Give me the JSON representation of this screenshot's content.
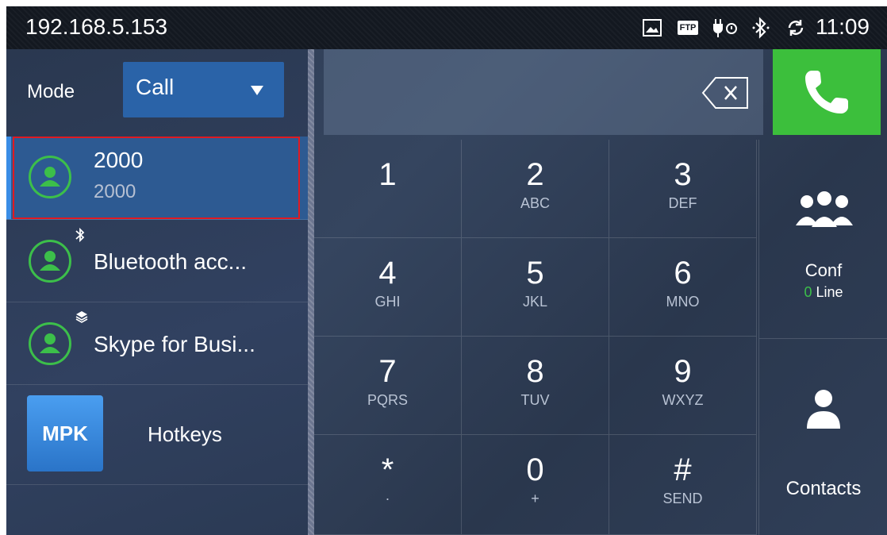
{
  "status_bar": {
    "ip": "192.168.5.153",
    "icons": [
      "image-icon",
      "ftp-icon",
      "usb-icon",
      "bluetooth-icon",
      "sync-icon"
    ],
    "ftp_label": "FTP",
    "time": "11:09"
  },
  "mode": {
    "label": "Mode",
    "selected": "Call"
  },
  "accounts": [
    {
      "title": "2000",
      "subtitle": "2000",
      "badge": null,
      "selected": true
    },
    {
      "title": "Bluetooth acc...",
      "badge": "bluetooth-icon",
      "selected": false
    },
    {
      "title": "Skype for Busi...",
      "badge": "layers-icon",
      "selected": false
    }
  ],
  "hotkeys": {
    "icon_label": "MPK",
    "label": "Hotkeys"
  },
  "keypad": [
    {
      "num": "1",
      "letters": ""
    },
    {
      "num": "2",
      "letters": "ABC"
    },
    {
      "num": "3",
      "letters": "DEF"
    },
    {
      "num": "4",
      "letters": "GHI"
    },
    {
      "num": "5",
      "letters": "JKL"
    },
    {
      "num": "6",
      "letters": "MNO"
    },
    {
      "num": "7",
      "letters": "PQRS"
    },
    {
      "num": "8",
      "letters": "TUV"
    },
    {
      "num": "9",
      "letters": "WXYZ"
    },
    {
      "num": "*",
      "letters": "·"
    },
    {
      "num": "0",
      "letters": "+"
    },
    {
      "num": "#",
      "letters": "SEND"
    }
  ],
  "side": {
    "conf_label": "Conf",
    "conf_count": "0",
    "conf_line": " Line",
    "contacts_label": "Contacts"
  },
  "colors": {
    "call_green": "#3cbf3c",
    "account_green": "#3cbf4a",
    "select_blue": "#2a63a8",
    "highlight_red": "#e01a22"
  }
}
